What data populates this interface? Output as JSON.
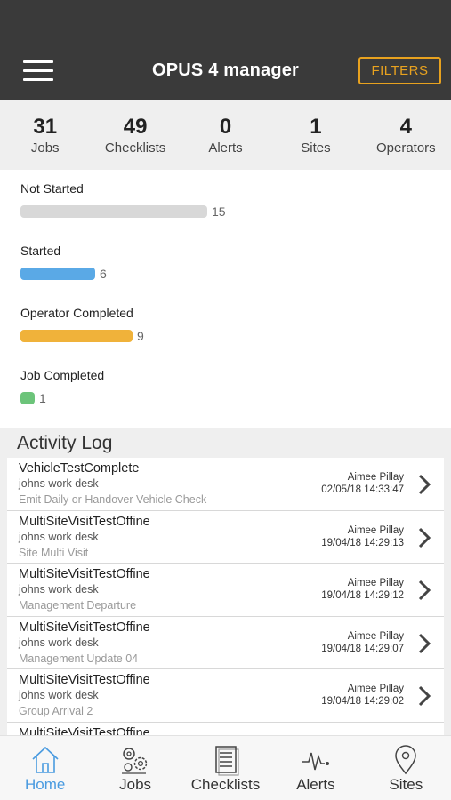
{
  "header": {
    "title": "OPUS 4 manager",
    "filters_label": "FILTERS"
  },
  "stats": [
    {
      "value": "31",
      "label": "Jobs"
    },
    {
      "value": "49",
      "label": "Checklists"
    },
    {
      "value": "0",
      "label": "Alerts"
    },
    {
      "value": "1",
      "label": "Sites"
    },
    {
      "value": "4",
      "label": "Operators"
    }
  ],
  "progress": [
    {
      "label": "Not Started",
      "count": "15",
      "value": 15,
      "color": "#d8d8d8"
    },
    {
      "label": "Started",
      "count": "6",
      "value": 6,
      "color": "#5aa9e6"
    },
    {
      "label": "Operator Completed",
      "count": "9",
      "value": 9,
      "color": "#f0b23a"
    },
    {
      "label": "Job Completed",
      "count": "1",
      "value": 1,
      "color": "#6cc47a"
    }
  ],
  "activity": {
    "title": "Activity Log",
    "items": [
      {
        "title": "VehicleTestComplete",
        "subtitle": "johns work desk",
        "description": "Emit Daily or Handover Vehicle Check",
        "user": "Aimee Pillay",
        "date": "02/05/18 14:33:47"
      },
      {
        "title": "MultiSiteVisitTestOffine",
        "subtitle": "johns work desk",
        "description": "Site Multi Visit",
        "user": "Aimee Pillay",
        "date": "19/04/18 14:29:13"
      },
      {
        "title": "MultiSiteVisitTestOffine",
        "subtitle": "johns work desk",
        "description": "Management Departure",
        "user": "Aimee Pillay",
        "date": "19/04/18 14:29:12"
      },
      {
        "title": "MultiSiteVisitTestOffine",
        "subtitle": "johns work desk",
        "description": "Management Update 04",
        "user": "Aimee Pillay",
        "date": "19/04/18 14:29:07"
      },
      {
        "title": "MultiSiteVisitTestOffine",
        "subtitle": "johns work desk",
        "description": "Group Arrival 2",
        "user": "Aimee Pillay",
        "date": "19/04/18 14:29:02"
      },
      {
        "title": "MultiSiteVisitTestOffine",
        "subtitle": "",
        "description": "",
        "user": "",
        "date": ""
      }
    ]
  },
  "nav": [
    {
      "label": "Home",
      "icon": "home-icon",
      "active": true
    },
    {
      "label": "Jobs",
      "icon": "jobs-gears-icon",
      "active": false
    },
    {
      "label": "Checklists",
      "icon": "checklist-icon",
      "active": false
    },
    {
      "label": "Alerts",
      "icon": "pulse-icon",
      "active": false
    },
    {
      "label": "Sites",
      "icon": "location-pin-icon",
      "active": false
    }
  ],
  "colors": {
    "header_bg": "#3a3a3a",
    "accent": "#e8a21f",
    "active_nav": "#4a9be0"
  }
}
